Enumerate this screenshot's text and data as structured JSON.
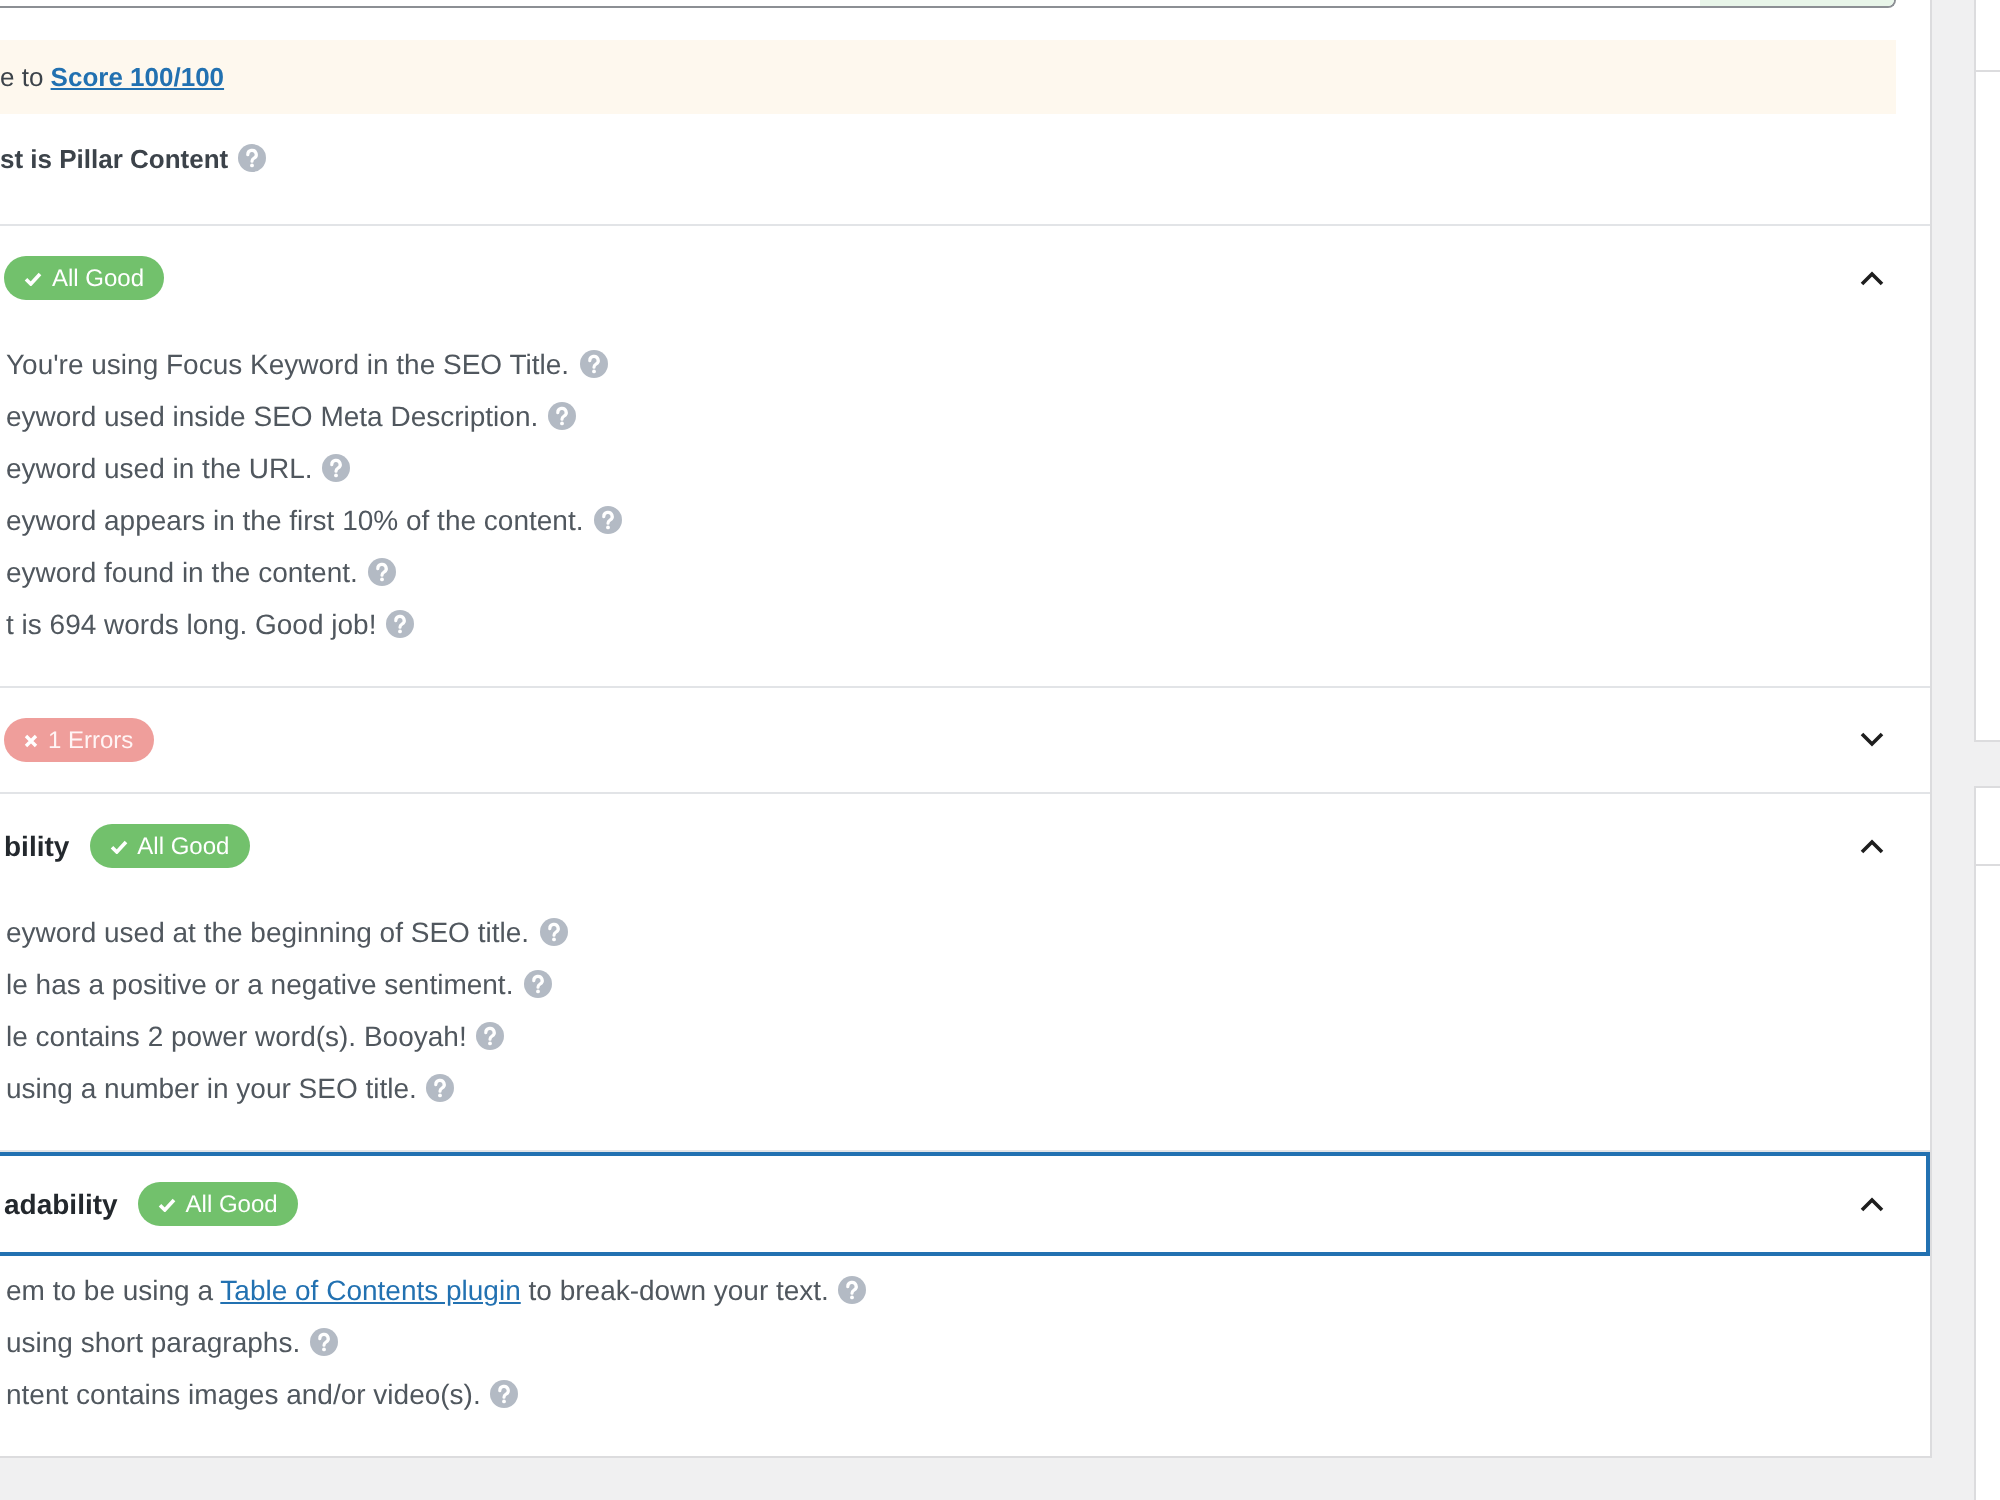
{
  "notice": {
    "text": "e to ",
    "link": "Score 100/100"
  },
  "pillar_content": {
    "label": "st is Pillar Content"
  },
  "sections": [
    {
      "badge": {
        "kind": "good",
        "text": "All Good"
      },
      "expanded": true,
      "focused": false,
      "items": [
        {
          "text": "You're using Focus Keyword in the SEO Title."
        },
        {
          "text": "eyword used inside SEO Meta Description."
        },
        {
          "text": "eyword used in the URL."
        },
        {
          "text": "eyword appears in the first 10% of the content."
        },
        {
          "text": "eyword found in the content."
        },
        {
          "text": "t is 694 words long. Good job!"
        }
      ]
    },
    {
      "badge": {
        "kind": "error",
        "text": "1 Errors"
      },
      "expanded": false,
      "focused": false
    },
    {
      "title": "bility",
      "badge": {
        "kind": "good",
        "text": "All Good"
      },
      "expanded": true,
      "focused": false,
      "items": [
        {
          "text": "eyword used at the beginning of SEO title."
        },
        {
          "text": "le has a positive or a negative sentiment."
        },
        {
          "text": "le contains 2 power word(s). Booyah!"
        },
        {
          "text": "using a number in your SEO title."
        }
      ]
    },
    {
      "title": "adability",
      "badge": {
        "kind": "good",
        "text": "All Good"
      },
      "expanded": true,
      "focused": true,
      "items": [
        {
          "text": "em to be using a ",
          "link": "Table of Contents plugin",
          "text_after": " to break-down your text."
        },
        {
          "text": "using short paragraphs."
        },
        {
          "text": "ntent contains images and/or video(s)."
        }
      ]
    }
  ]
}
